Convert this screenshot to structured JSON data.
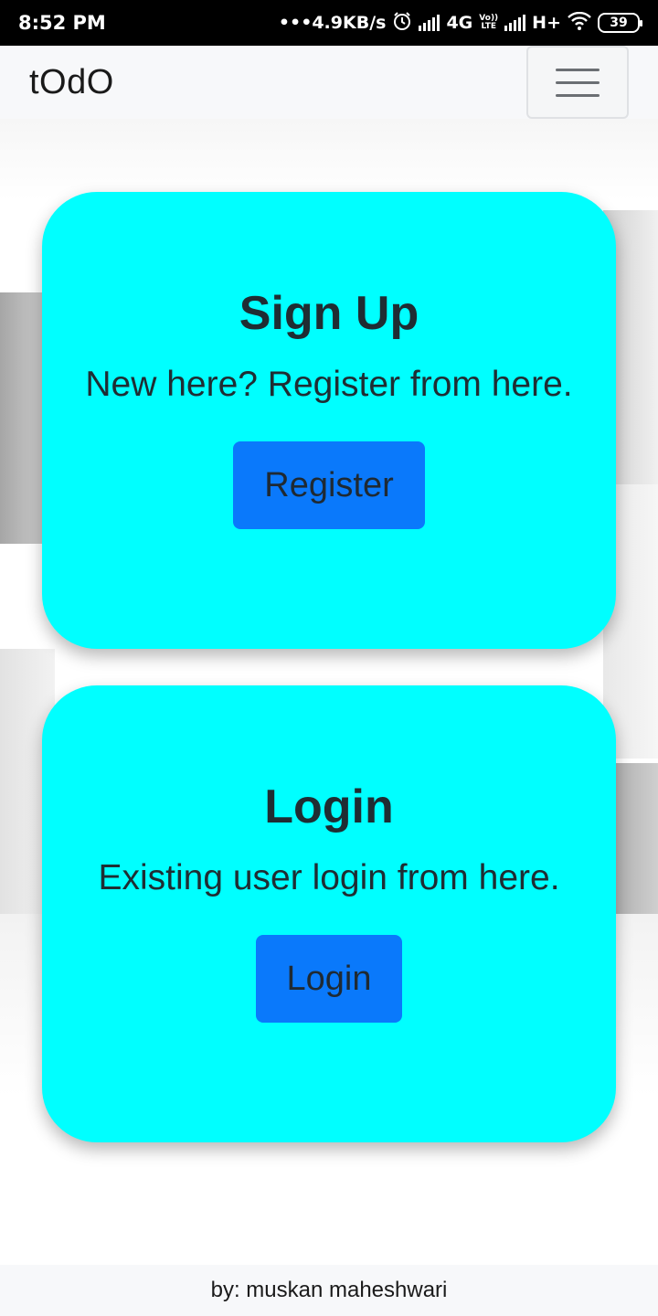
{
  "status_bar": {
    "time": "8:52 PM",
    "net_speed": "•••4.9KB/s",
    "network_4g": "4G",
    "volte_top": "Vo))",
    "volte_bottom": "LTE",
    "network_h": "H+",
    "battery": "39",
    "icons": [
      "alarm-icon",
      "signal-icon",
      "signal-icon",
      "wifi-icon",
      "battery-icon"
    ]
  },
  "navbar": {
    "brand": "tOdO",
    "menu_icon": "hamburger-menu-icon"
  },
  "cards": {
    "signup": {
      "title": "Sign Up",
      "description": "New here? Register from here.",
      "button": "Register"
    },
    "login": {
      "title": "Login",
      "description": "Existing user login from here.",
      "button": "Login"
    }
  },
  "footer": {
    "credit": "by: muskan maheshwari"
  },
  "colors": {
    "card": "#00ffff",
    "button": "#0a79fb",
    "navbar": "#f7f8fa"
  }
}
